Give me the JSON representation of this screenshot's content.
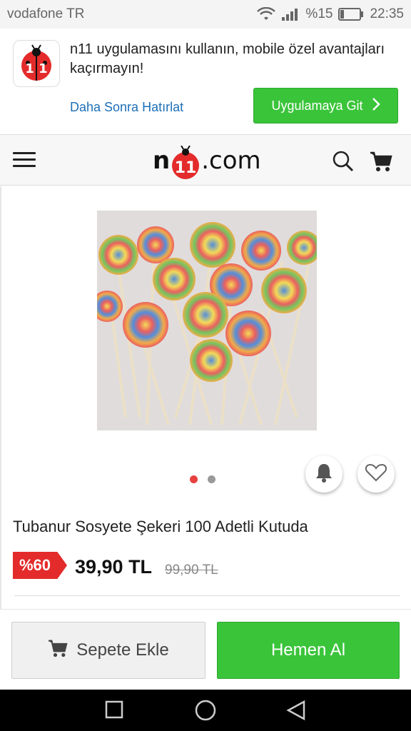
{
  "status_bar": {
    "carrier": "vodafone TR",
    "battery": "%15",
    "time": "22:35",
    "icons": [
      "wifi-icon",
      "signal-icon",
      "battery-icon"
    ]
  },
  "app_banner": {
    "app_icon": "n11-app-icon",
    "message": "n11 uygulamasını kullanın, mobile özel avantajları kaçırmayın!",
    "remind_later": "Daha Sonra Hatırlat",
    "go_to_app": "Uygulamaya Git"
  },
  "header": {
    "logo_prefix": "n",
    "logo_badge": "11",
    "logo_suffix": ".com",
    "icons": [
      "menu-icon",
      "search-icon",
      "cart-icon"
    ]
  },
  "product": {
    "title": "Tubanur Sosyete Şekeri 100 Adetli Kutuda",
    "discount": "%60",
    "price": "39,90 TL",
    "old_price": "99,90 TL",
    "image_count": 2,
    "active_image": 1
  },
  "actions": {
    "add_to_cart": "Sepete Ekle",
    "buy_now": "Hemen Al"
  },
  "colors": {
    "green": "#3ac43a",
    "red": "#e42b2b",
    "link": "#1d6fb8"
  }
}
